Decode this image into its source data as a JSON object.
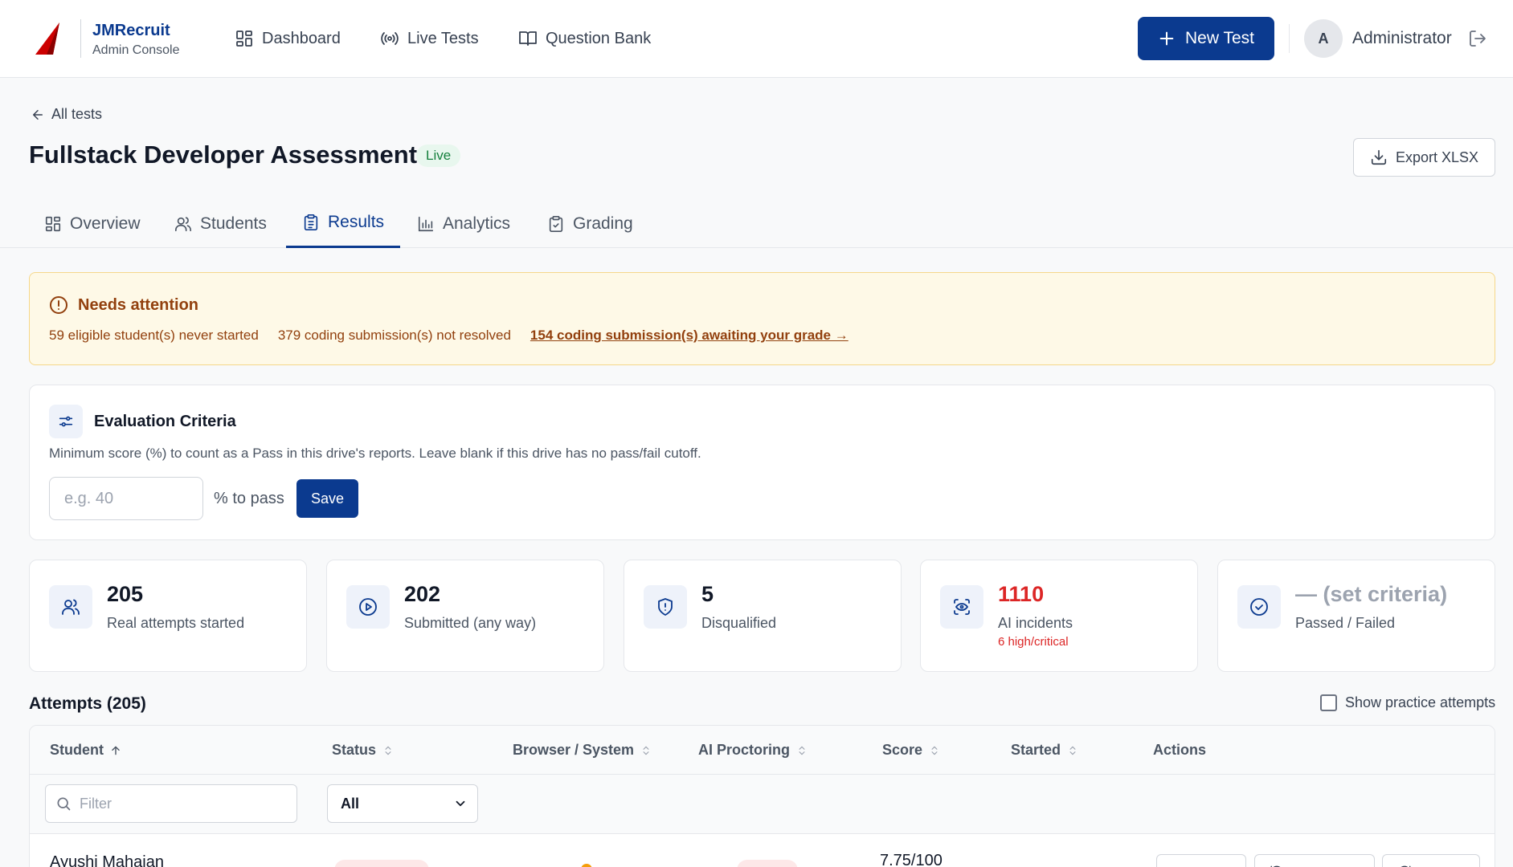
{
  "brand": {
    "name": "JMRecruit",
    "subtitle": "Admin Console",
    "accent_color": "#cc0000",
    "primary_color": "#0b3a8f"
  },
  "nav": {
    "items": [
      {
        "label": "Dashboard",
        "icon": "dashboard-icon"
      },
      {
        "label": "Live Tests",
        "icon": "broadcast-icon"
      },
      {
        "label": "Question Bank",
        "icon": "book-icon"
      }
    ],
    "new_test_label": "New Test"
  },
  "user": {
    "initial": "A",
    "name": "Administrator"
  },
  "page": {
    "back_label": "All tests",
    "title": "Fullstack Developer Assessment",
    "status_badge": "Live",
    "export_label": "Export XLSX"
  },
  "tabs": [
    {
      "label": "Overview",
      "icon": "grid-icon",
      "active": false
    },
    {
      "label": "Students",
      "icon": "users-icon",
      "active": false
    },
    {
      "label": "Results",
      "icon": "clipboard-list-icon",
      "active": true
    },
    {
      "label": "Analytics",
      "icon": "bar-chart-icon",
      "active": false
    },
    {
      "label": "Grading",
      "icon": "clipboard-check-icon",
      "active": false
    }
  ],
  "alert": {
    "title": "Needs attention",
    "items": [
      "59 eligible student(s) never started",
      "379 coding submission(s) not resolved"
    ],
    "link": "154 coding submission(s) awaiting your grade →"
  },
  "criteria": {
    "title": "Evaluation Criteria",
    "description": "Minimum score (%) to count as a Pass in this drive's reports. Leave blank if this drive has no pass/fail cutoff.",
    "placeholder": "e.g. 40",
    "suffix": "% to pass",
    "save_label": "Save"
  },
  "stats": [
    {
      "value": "205",
      "label": "Real attempts started",
      "icon": "users-icon"
    },
    {
      "value": "202",
      "label": "Submitted (any way)",
      "icon": "play-circle-icon"
    },
    {
      "value": "5",
      "label": "Disqualified",
      "icon": "shield-icon"
    },
    {
      "value": "1110",
      "label": "AI incidents",
      "sub": "6 high/critical",
      "icon": "scan-eye-icon"
    },
    {
      "value": "— (set criteria)",
      "label": "Passed / Failed",
      "icon": "check-circle-icon"
    }
  ],
  "attempts": {
    "title": "Attempts (205)",
    "show_practice_label": "Show practice attempts",
    "columns": [
      "Student",
      "Status",
      "Browser / System",
      "AI Proctoring",
      "Score",
      "Started",
      "Actions"
    ],
    "filter_placeholder": "Filter",
    "status_filter": "All",
    "rows": [
      {
        "student": "Ayushi Mahajan",
        "score": "7.75/100"
      }
    ]
  }
}
